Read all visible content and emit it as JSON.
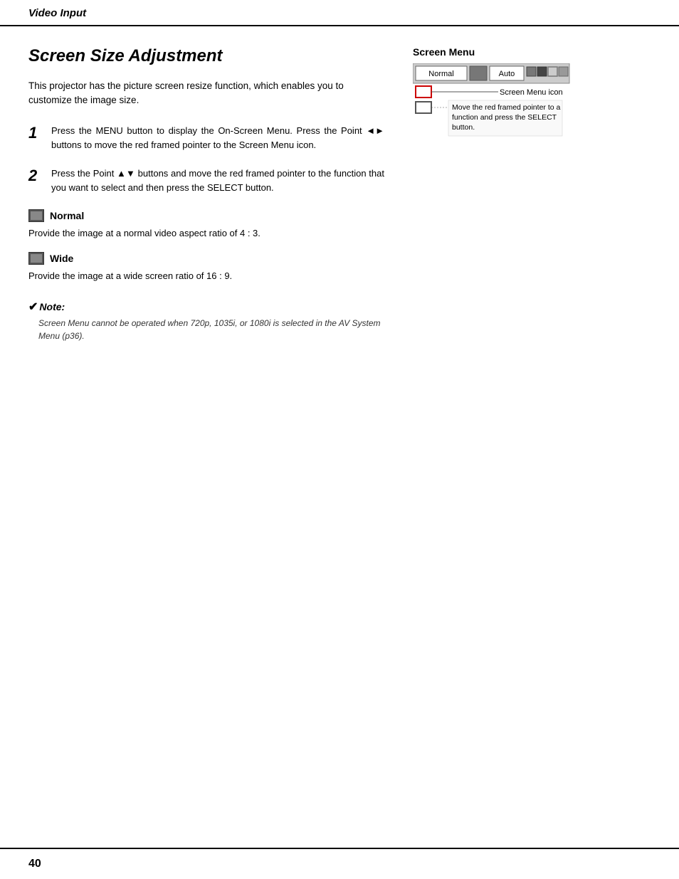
{
  "header": {
    "title": "Video Input"
  },
  "page": {
    "title": "Screen Size Adjustment",
    "intro": "This projector has the picture screen resize function, which enables you to customize the image size.",
    "page_number": "40"
  },
  "steps": [
    {
      "number": "1",
      "text": "Press the MENU button to display the On-Screen Menu.  Press the Point ◄► buttons to move the red framed pointer to the Screen Menu icon."
    },
    {
      "number": "2",
      "text": "Press the Point ▲▼ buttons and move the red framed pointer to the function that you want to select and then press the SELECT button."
    }
  ],
  "features": [
    {
      "label": "Normal",
      "description": "Provide the image at a normal video aspect ratio of 4 : 3."
    },
    {
      "label": "Wide",
      "description": "Provide the image at a wide screen ratio of 16 : 9."
    }
  ],
  "note": {
    "label": "Note:",
    "text": "Screen Menu cannot be operated when 720p, 1035i, or 1080i is selected in the AV System Menu (p36)."
  },
  "screen_menu": {
    "label": "Screen Menu",
    "normal_btn": "Normal",
    "auto_btn": "Auto",
    "icon_label": "Screen Menu icon",
    "annotation": "Move the red framed pointer to a function and press the SELECT button."
  }
}
